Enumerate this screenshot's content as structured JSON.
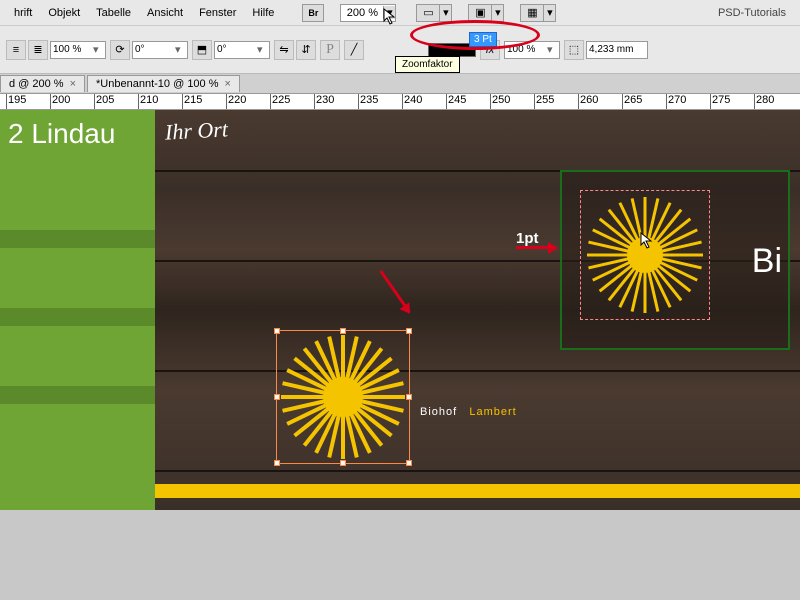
{
  "menu": {
    "items": [
      "hrift",
      "Objekt",
      "Tabelle",
      "Ansicht",
      "Fenster",
      "Hilfe"
    ],
    "br": "Br",
    "zoom": "200 %",
    "psd": "PSD-Tutorials"
  },
  "toolbar": {
    "pct1": "100 %",
    "deg1": "0°",
    "deg2": "0°",
    "tooltip": "Zoomfaktor",
    "stroke_val": "3 Pt",
    "pct2": "100 %",
    "mm": "4,233 mm"
  },
  "tabs": {
    "t1": "d @ 200 %",
    "t2": "*Unbenannt-10 @ 100 %"
  },
  "ruler": {
    "marks": [
      "195",
      "200",
      "205",
      "210",
      "215",
      "220",
      "225",
      "230",
      "235",
      "240",
      "245",
      "250",
      "255",
      "260",
      "265",
      "270",
      "275",
      "280"
    ]
  },
  "canvas": {
    "lindau": "2 Lindau",
    "ihr": "Ihr Ort",
    "biohof": "Biohof",
    "lambert": "Lambert",
    "bi": "Bi",
    "pt": "1pt"
  }
}
